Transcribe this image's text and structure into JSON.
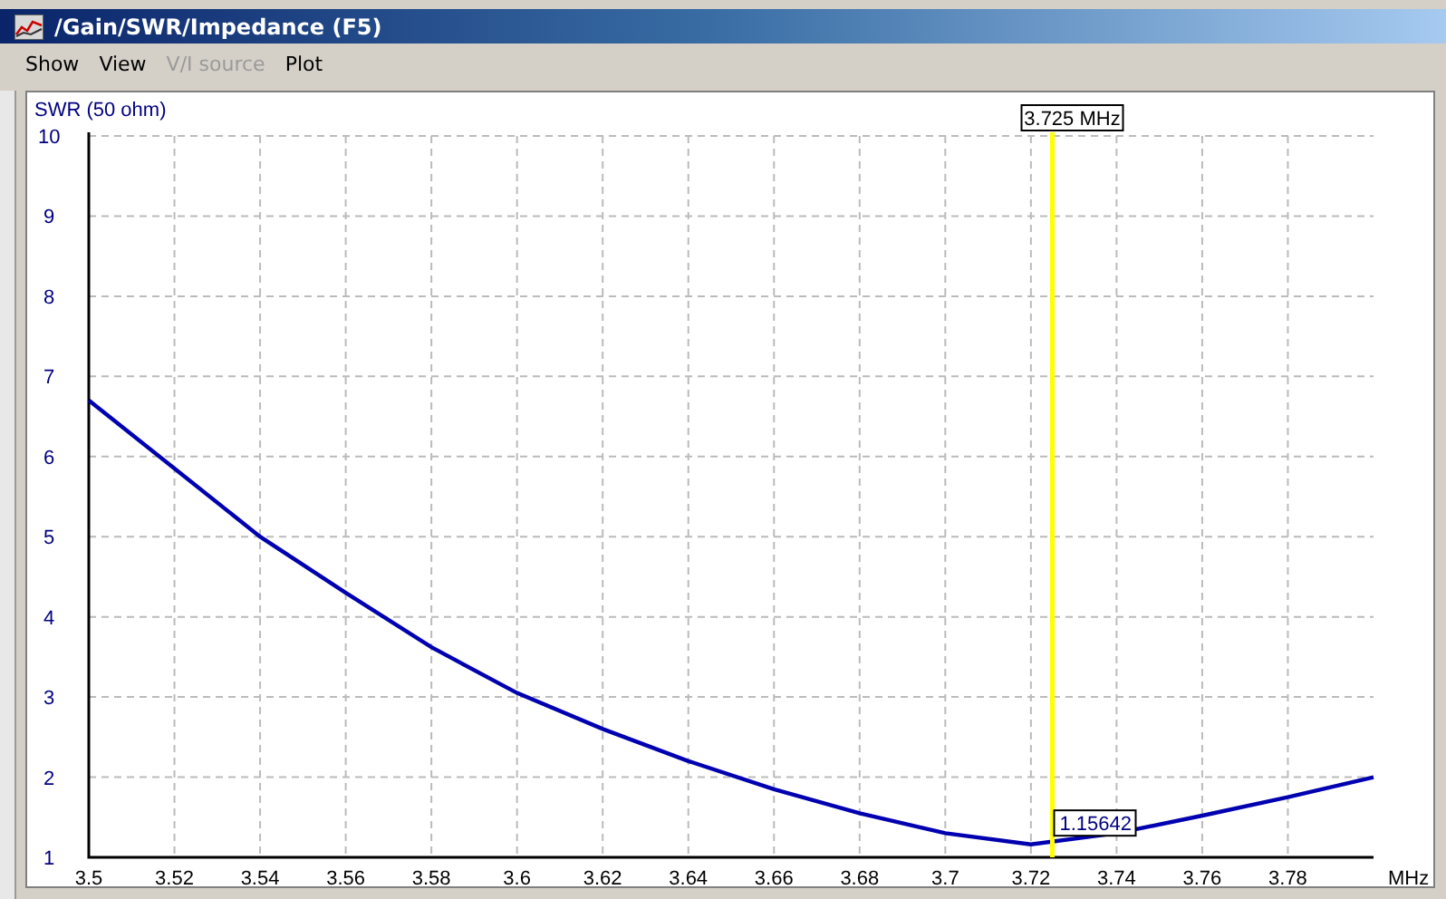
{
  "window": {
    "title": "/Gain/SWR/Impedance (F5)"
  },
  "menu": [
    {
      "label": "Show",
      "disabled": false
    },
    {
      "label": "View",
      "disabled": false
    },
    {
      "label": "V/I source",
      "disabled": true
    },
    {
      "label": "Plot",
      "disabled": false
    }
  ],
  "plot": {
    "chart_data": {
      "type": "line",
      "ylabel": "SWR (50 ohm)",
      "xlabel": "MHz",
      "x": [
        3.5,
        3.52,
        3.54,
        3.56,
        3.58,
        3.6,
        3.62,
        3.64,
        3.66,
        3.68,
        3.7,
        3.72,
        3.74,
        3.76,
        3.78,
        3.8
      ],
      "series": [
        {
          "color": "#0000b0",
          "values": [
            6.7,
            5.85,
            5.0,
            4.3,
            3.62,
            3.05,
            2.6,
            2.2,
            1.85,
            1.55,
            1.3,
            1.16,
            1.3,
            1.52,
            1.75,
            2.0
          ]
        }
      ],
      "xlim": [
        3.5,
        3.8
      ],
      "ylim": [
        1,
        10
      ],
      "xticks": [
        3.5,
        3.52,
        3.54,
        3.56,
        3.58,
        3.6,
        3.62,
        3.64,
        3.66,
        3.68,
        3.7,
        3.72,
        3.74,
        3.76,
        3.78
      ],
      "yticks": [
        1,
        2,
        3,
        4,
        5,
        6,
        7,
        8,
        9,
        10
      ],
      "grid": true,
      "ref_lines": [
        {
          "axis": "x",
          "value": 3.725,
          "label": "3.725 MHz",
          "color": "#ffff00"
        }
      ],
      "annotations": [
        {
          "x": 3.725,
          "y": 1.15642,
          "text": "1.15642"
        }
      ]
    }
  }
}
